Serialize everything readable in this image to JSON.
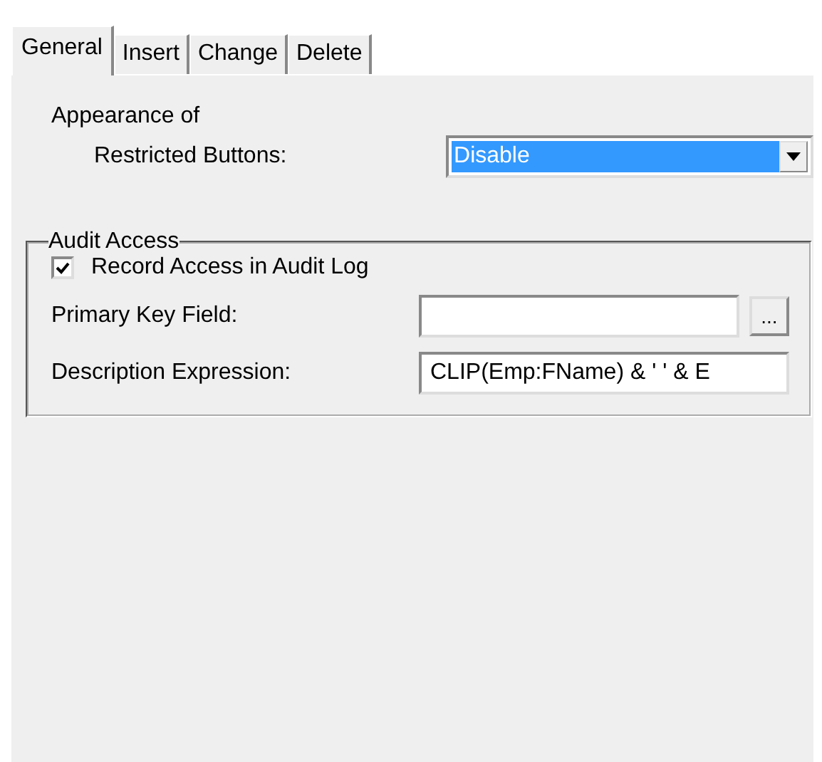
{
  "tabs": [
    {
      "label": "General",
      "selected": true
    },
    {
      "label": "Insert",
      "selected": false
    },
    {
      "label": "Change",
      "selected": false
    },
    {
      "label": "Delete",
      "selected": false
    }
  ],
  "appearance": {
    "heading": "Appearance of",
    "label": "Restricted Buttons:",
    "value": "Disable",
    "selected": true
  },
  "audit_access": {
    "title": "Audit Access",
    "checkbox": {
      "label": "Record Access in Audit Log",
      "checked": true
    },
    "fields": [
      {
        "kind": "lookup",
        "label": "Primary Key Field:",
        "button": "..."
      },
      {
        "kind": "text",
        "label": "Description Expression:",
        "value": "CLIP(Emp:FName) & ' ' & E"
      }
    ]
  }
}
